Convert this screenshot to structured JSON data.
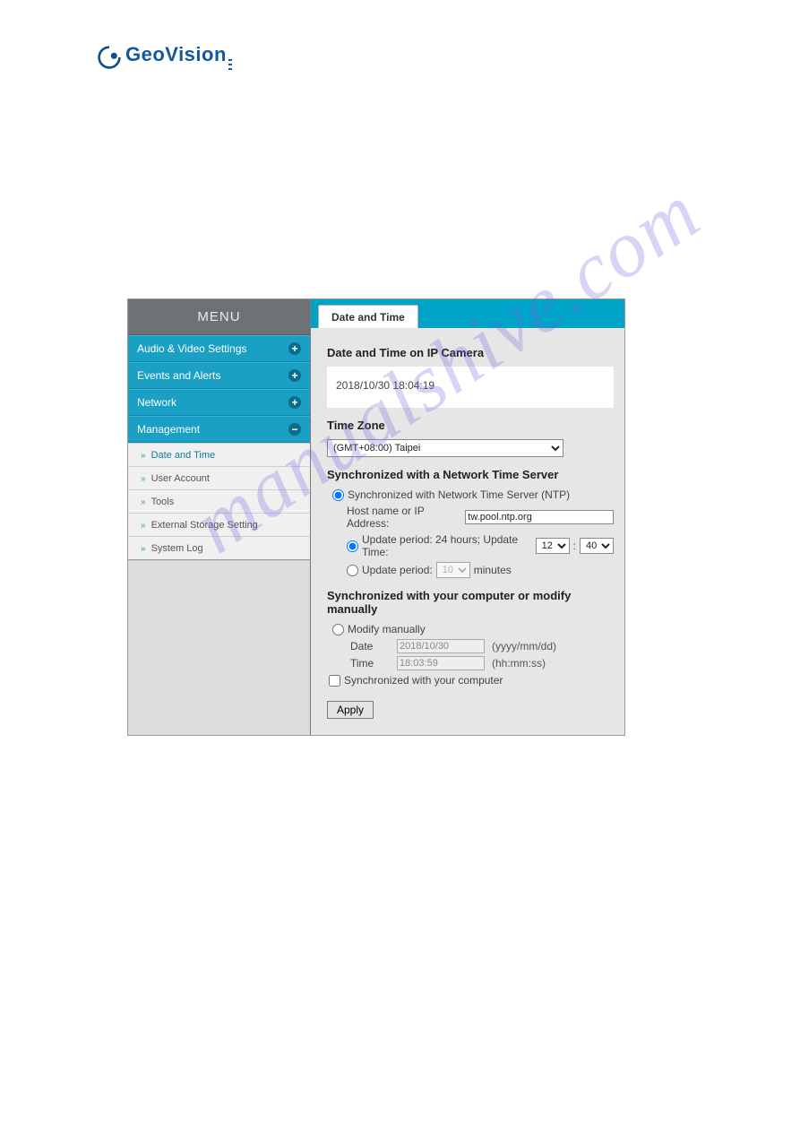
{
  "logo": {
    "brand_geo": "Geo",
    "brand_vision": "Vision"
  },
  "sidebar": {
    "title": "MENU",
    "sections": [
      {
        "label": "Audio & Video Settings",
        "icon": "+"
      },
      {
        "label": "Events and Alerts",
        "icon": "+"
      },
      {
        "label": "Network",
        "icon": "+"
      },
      {
        "label": "Management",
        "icon": "−"
      }
    ],
    "submenu": [
      {
        "label": "Date and Time",
        "active": true
      },
      {
        "label": "User Account"
      },
      {
        "label": "Tools"
      },
      {
        "label": "External Storage Setting"
      },
      {
        "label": "System Log"
      }
    ]
  },
  "tab": {
    "label": "Date and Time"
  },
  "datetime": {
    "heading": "Date and Time on IP Camera",
    "value": "2018/10/30 18:04:19"
  },
  "timezone": {
    "heading": "Time Zone",
    "selected": "(GMT+08:00) Taipei"
  },
  "ntp": {
    "heading": "Synchronized with a Network Time Server",
    "radio_label": "Synchronized with Network Time Server (NTP)",
    "host_label": "Host name or IP Address:",
    "host_value": "tw.pool.ntp.org",
    "period24_label_pre": "Update period: 24 hours; Update Time:",
    "hour": "12",
    "minute": "40",
    "periodmin_label_pre": "Update period:",
    "periodmin_value": "10",
    "periodmin_unit": "minutes"
  },
  "manual": {
    "heading": "Synchronized with your computer or modify manually",
    "radio_label": "Modify manually",
    "date_label": "Date",
    "date_value": "2018/10/30",
    "date_hint": "(yyyy/mm/dd)",
    "time_label": "Time",
    "time_value": "18:03:59",
    "time_hint": "(hh:mm:ss)",
    "sync_label": "Synchronized with your computer"
  },
  "apply_label": "Apply",
  "watermark": "manualshive.com"
}
